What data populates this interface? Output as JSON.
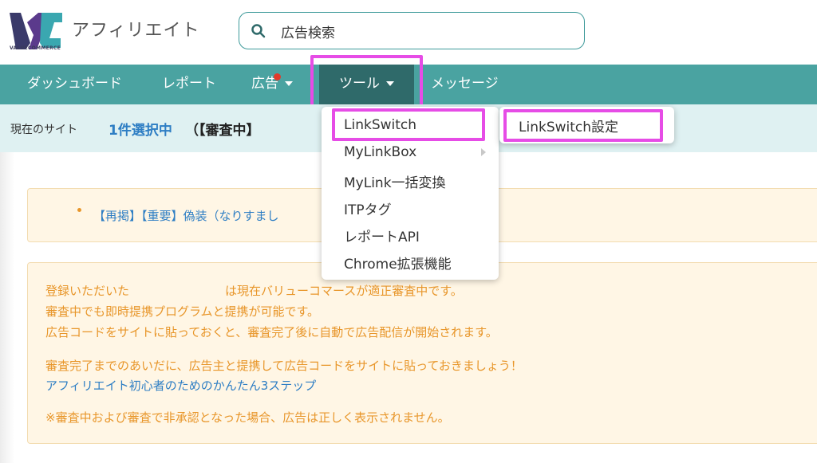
{
  "header": {
    "logo_text": "VALUECOMMERCE",
    "app_title": "アフィリエイト",
    "search_value": "広告検索"
  },
  "nav": {
    "items": [
      {
        "label": "ダッシュボード"
      },
      {
        "label": "レポート"
      },
      {
        "label": "広告"
      },
      {
        "label": "ツール"
      },
      {
        "label": "メッセージ"
      }
    ]
  },
  "site": {
    "label": "現在のサイト",
    "count": "1件選択中",
    "status": "（【審査中】"
  },
  "notice1": {
    "link": "【再掲】【重要】偽装（なりすまし"
  },
  "notice2": {
    "line1_a": "登録いただいた",
    "line1_b": "は現在バリューコマースが適正審査中です。",
    "line2": "審査中でも即時提携プログラムと提携が可能です。",
    "line3": "広告コードをサイトに貼っておくと、審査完了後に自動で広告配信が開始されます。",
    "line4": "審査完了までのあいだに、広告主と提携して広告コードをサイトに貼っておきましょう！",
    "link": "アフィリエイト初心者のためのかんたん3ステップ",
    "line6": "※審査中および審査で非承認となった場合、広告は正しく表示されません。"
  },
  "tools_menu": {
    "items": [
      {
        "label": "LinkSwitch"
      },
      {
        "label": "MyLinkBox"
      },
      {
        "label": "MyLink一括変換"
      },
      {
        "label": "ITPタグ"
      },
      {
        "label": "レポートAPI"
      },
      {
        "label": "Chrome拡張機能"
      }
    ]
  },
  "submenu": {
    "items": [
      {
        "label": "LinkSwitch設定"
      }
    ]
  },
  "colors": {
    "nav_bg": "#4aa3a1",
    "nav_active": "#2f6a6a",
    "highlight": "#e64ce6",
    "link": "#2e7ec4",
    "notice_text": "#e8962a",
    "notice_bg": "#fff6e5",
    "badge_dot": "#e03a2b"
  },
  "icons": [
    "search-icon",
    "caret-down-icon",
    "chevron-right-icon",
    "notification-dot-icon"
  ]
}
